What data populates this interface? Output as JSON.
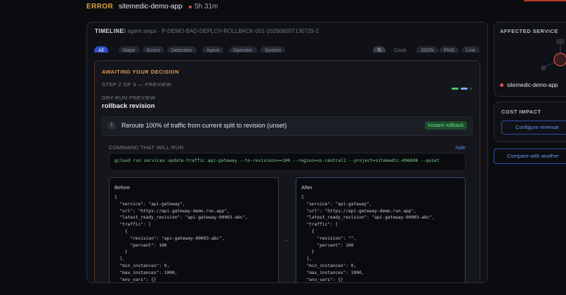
{
  "header": {
    "status": "ERROR",
    "separator": "·",
    "service": "sitemedic-demo-app",
    "duration": "5h 31m"
  },
  "timeline": {
    "title": "TIMELINE",
    "meta": "9 agent steps · P-DEMO-BAD-DEPLOY-ROLLBACK-001-20260605T130729-2",
    "filters": [
      "All",
      "Major",
      "Errors",
      "Detection",
      "Agent",
      "Operator",
      "System"
    ],
    "views": [
      "Tr",
      "Clock",
      "JSON",
      "PNG",
      "Link"
    ]
  },
  "decision": {
    "awaiting": "AWAITING YOUR DECISION",
    "step": "STEP 2 OF 3 — PREVIEW",
    "dry_run_label": "DRY-RUN PREVIEW",
    "action": "rollback revision",
    "step_number": "1",
    "step_text": "Reroute 100% of traffic from current split to revision (unset)",
    "badge": "Instant rollback",
    "command_label": "COMMAND THAT WILL RUN",
    "hide": "hide",
    "command": "gcloud run services update-traffic api-gateway --to-revisions==100 --region=us-central1 --project=sitemedic-496608 --quiet",
    "before_title": "Before",
    "after_title": "After",
    "arrow": "→",
    "before_json": "{\n  \"service\": \"api-gateway\",\n  \"url\": \"https://api-gateway-demo.run.app\",\n  \"latest_ready_revision\": \"api-gateway-00003-abc\",\n  \"traffic\": [\n    {\n      \"revision\": \"api-gateway-00003-abc\",\n      \"percent\": 100\n    }\n  ],\n  \"min_instances\": 0,\n  \"max_instances\": 1000,\n  \"env_vars\": {}",
    "after_json": "{\n  \"service\": \"api-gateway\",\n  \"url\": \"https://api-gateway-demo.run.app\",\n  \"latest_ready_revision\": \"api-gateway-00003-abc\",\n  \"traffic\": [\n    {\n      \"revision\": \"\",\n      \"percent\": 100\n    }\n  ],\n  \"min_instances\": 0,\n  \"max_instances\": 1000,\n  \"env_vars\": {}"
  },
  "affected": {
    "title": "AFFECTED SERVICE",
    "service": "sitemedic-demo-app"
  },
  "cost": {
    "title": "COST IMPACT",
    "configure": "Configure revenue"
  },
  "compare": "Compare with another",
  "colors": {
    "accent": "#2f4ec7",
    "error": "#d9534f",
    "warning": "#e39b4c",
    "success": "#6fdc8c",
    "link": "#5b8def"
  }
}
